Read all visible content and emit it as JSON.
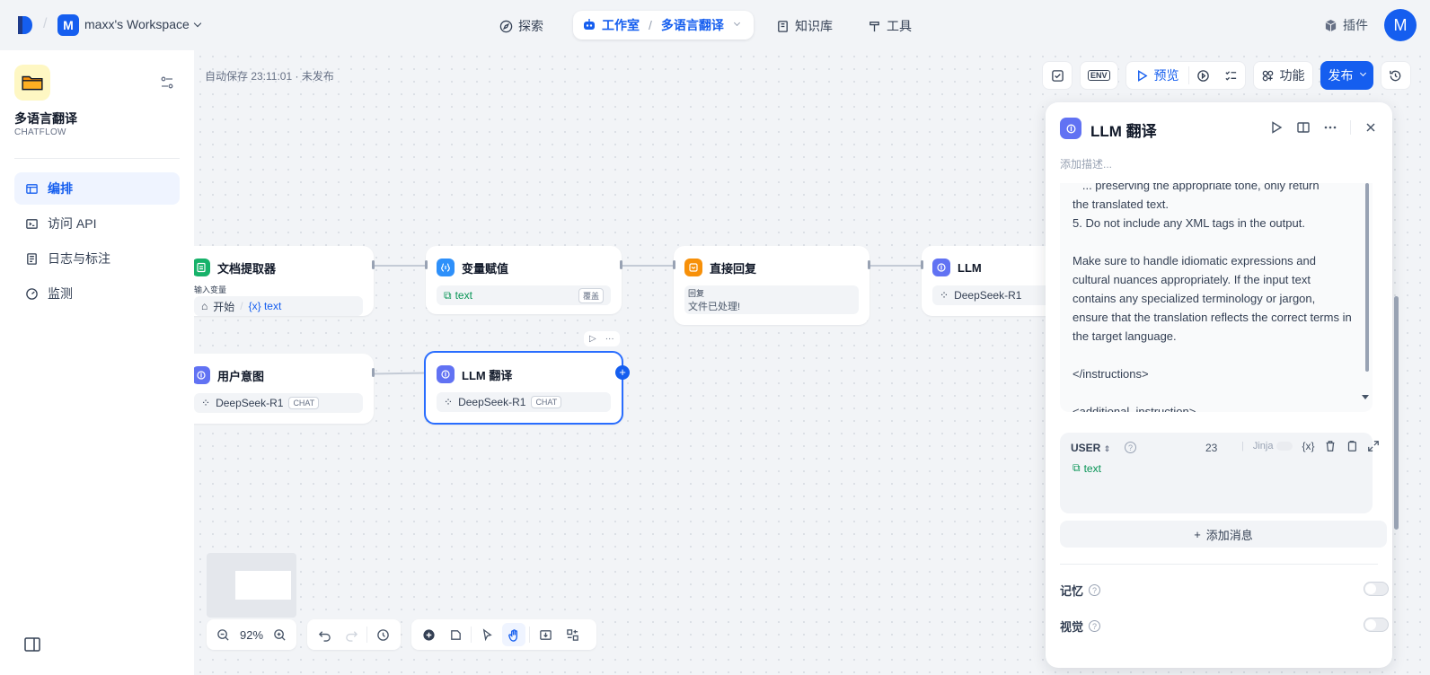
{
  "topbar": {
    "workspace_initial": "M",
    "workspace_name": "maxx's Workspace",
    "nav": {
      "explore": "探索",
      "studio": "工作室",
      "current_app": "多语言翻译",
      "knowledge": "知识库",
      "tools": "工具"
    },
    "plugins": "插件",
    "avatar_initial": "M"
  },
  "sidebar": {
    "app_name": "多语言翻译",
    "app_type": "CHATFLOW",
    "items": [
      {
        "label": "编排",
        "icon": "layout-icon",
        "active": true
      },
      {
        "label": "访问 API",
        "icon": "terminal-icon",
        "active": false
      },
      {
        "label": "日志与标注",
        "icon": "file-list-icon",
        "active": false
      },
      {
        "label": "监测",
        "icon": "gauge-icon",
        "active": false
      }
    ]
  },
  "canvas": {
    "autosave": "自动保存 23:11:01 · 未发布",
    "buttons": {
      "preview": "预览",
      "features": "功能",
      "publish": "发布",
      "env": "ENV"
    },
    "zoom": "92%",
    "nodes": {
      "doc_extractor": {
        "title": "文档提取器",
        "sub": "输入变量",
        "input_source": "开始",
        "input_var": "{x} text"
      },
      "var_assign": {
        "title": "变量赋值",
        "var": "text",
        "mode": "覆盖"
      },
      "direct_reply": {
        "title": "直接回复",
        "sub": "回复",
        "content": "文件已处理!"
      },
      "llm": {
        "title": "LLM",
        "model": "DeepSeek-R1"
      },
      "intent": {
        "title": "用户意图",
        "model": "DeepSeek-R1",
        "mode": "CHAT"
      },
      "llm_translate": {
        "title": "LLM 翻译",
        "model": "DeepSeek-R1",
        "mode": "CHAT"
      }
    }
  },
  "panel": {
    "title": "LLM 翻译",
    "description_placeholder": "添加描述...",
    "prompt_text": "   ... preserving the appropriate tone, only return\nthe translated text.\n5. Do not include any XML tags in the output.\n\nMake sure to handle idiomatic expressions and cultural nuances appropriately. If the input text contains any specialized terminology or jargon, ensure that the translation reflects the correct terms in the target language.\n\n</instructions>\n\n<additional_instruction>",
    "user_role": "USER",
    "user_count": "23",
    "jinja": "Jinja",
    "var_button": "{x}",
    "user_var": "text",
    "add_message": "添加消息",
    "memory": "记忆",
    "vision": "视觉"
  },
  "colors": {
    "accent": "#155eef",
    "page_bg": "#f2f4f7"
  }
}
